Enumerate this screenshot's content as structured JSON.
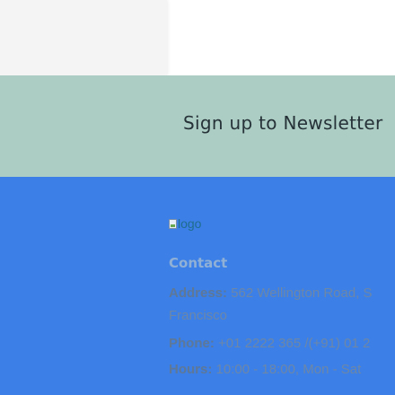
{
  "newsletter": {
    "title": "Sign up to Newsletter"
  },
  "footer": {
    "logo_alt": "logo",
    "contact_heading": "Contact",
    "address_label": "Address:",
    "address_line1": "562 Wellington Road, S",
    "address_line2": "Francisco",
    "phone_label": "Phone:",
    "phone_value": "+01 2222 365 /(+91) 01 2",
    "hours_label": "Hours:",
    "hours_value": "10:00 - 18:00, Mon - Sat"
  },
  "colors": {
    "newsletter_bg": "#abcdc3",
    "footer_bg": "#3c7fe6",
    "contact_heading": "#90b0d6",
    "info_text": "#6c87a8"
  },
  "icons": {
    "logo": "broken-image-icon"
  }
}
